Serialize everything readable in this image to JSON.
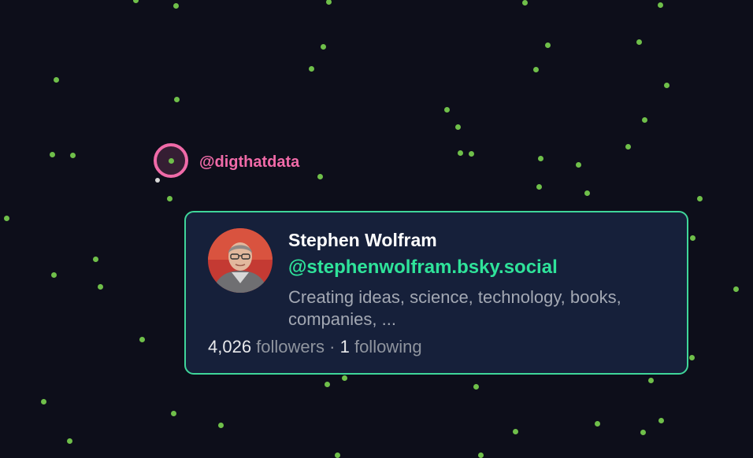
{
  "selected_node": {
    "handle": "@digthatdata"
  },
  "profile_card": {
    "display_name": "Stephen Wolfram",
    "handle": "@stephenwolfram.bsky.social",
    "bio": "Creating ideas, science, technology, books, companies, ...",
    "followers_count": "4,026",
    "followers_label": "followers",
    "separator": "·",
    "following_count": "1",
    "following_label": "following"
  },
  "colors": {
    "background": "#0d0e1a",
    "node": "#6fbf4a",
    "selected_accent": "#f06aa8",
    "card_border": "#3fd69a",
    "card_handle": "#2fe39a",
    "card_background": "#16203a"
  }
}
